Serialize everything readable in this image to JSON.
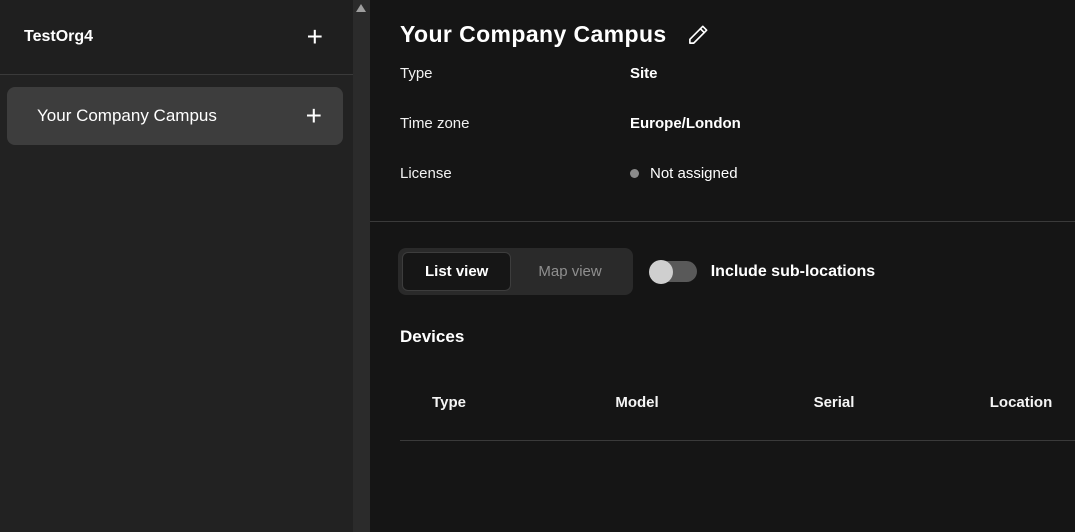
{
  "colors": {
    "sidebar_bg": "#222222",
    "sidebar_header_bg": "#1f1f1f",
    "selected_item_bg": "#3d3d3d",
    "main_bg": "#151515",
    "divider": "#3a3a3a",
    "muted_text": "#8f8f8f",
    "status_dot": "#8a8a8a",
    "toggle_track": "#595959",
    "toggle_knob": "#cfcfcf"
  },
  "sidebar": {
    "org": {
      "name": "TestOrg4",
      "add_label": "+"
    },
    "items": [
      {
        "label": "Your Company Campus",
        "add_label": "+",
        "selected": true
      }
    ]
  },
  "main": {
    "title": "Your Company Campus",
    "info_rows": [
      {
        "label": "Type",
        "value": "Site"
      },
      {
        "label": "Time zone",
        "value": "Europe/London"
      },
      {
        "label": "License",
        "value": "Not assigned",
        "has_dot": true
      }
    ],
    "view_toggle": {
      "options": [
        "List view",
        "Map view"
      ],
      "selected": "List view"
    },
    "sub_locations_toggle": {
      "label": "Include sub-locations",
      "state": "off"
    },
    "devices": {
      "heading": "Devices",
      "columns": [
        "Type",
        "Model",
        "Serial",
        "Location"
      ],
      "rows": []
    }
  }
}
